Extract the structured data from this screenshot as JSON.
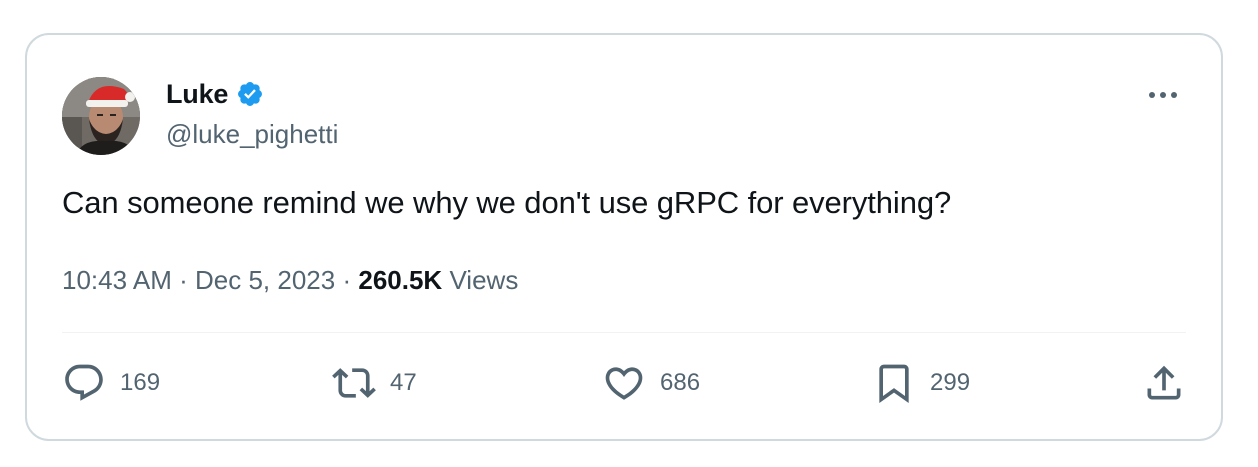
{
  "author": {
    "display_name": "Luke",
    "handle": "@luke_pighetti",
    "verified": true
  },
  "tweet": {
    "text": "Can someone remind we why we don't use gRPC for everything?",
    "time": "10:43 AM",
    "separator1": "·",
    "date": "Dec 5, 2023",
    "separator2": "·",
    "views_count": "260.5K",
    "views_label": "Views"
  },
  "actions": {
    "replies": "169",
    "retweets": "47",
    "likes": "686",
    "bookmarks": "299"
  },
  "icons": {
    "verified": "verified-badge-icon",
    "more": "more-horizontal-icon",
    "reply": "reply-icon",
    "retweet": "retweet-icon",
    "like": "heart-icon",
    "bookmark": "bookmark-icon",
    "share": "share-icon"
  },
  "colors": {
    "verified_blue": "#1d9bf0",
    "text_primary": "#0f1419",
    "text_secondary": "#536471",
    "border": "#cfd9de"
  }
}
